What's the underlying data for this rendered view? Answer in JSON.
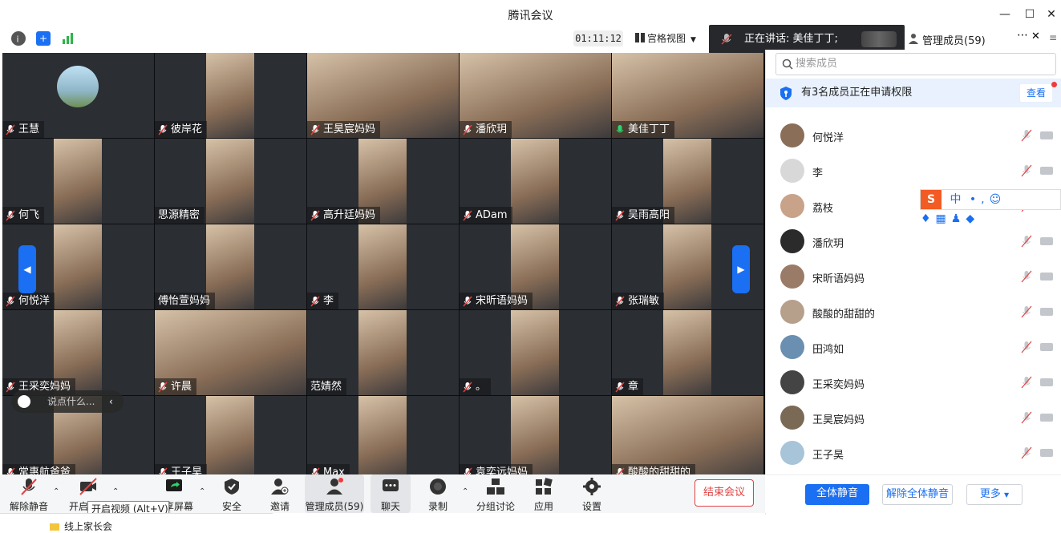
{
  "window": {
    "title": "腾讯会议"
  },
  "top_toolbar": {
    "timer": "01:11:12",
    "view_label": "宫格视图"
  },
  "speaking": {
    "text": "正在讲话: 美佳丁丁;"
  },
  "panel_header": {
    "title": "管理成员(59)"
  },
  "tiles": [
    [
      "王慧",
      "彼岸花",
      "王昊宸妈妈",
      "潘欣玥",
      "美佳丁丁"
    ],
    [
      "何飞",
      "思源精密",
      "高升廷妈妈",
      "ADam",
      "吴雨高阳"
    ],
    [
      "何悦洋",
      "傅怡萱妈妈",
      "李",
      "宋昕语妈妈",
      "张瑞敏"
    ],
    [
      "王采奕妈妈",
      "许晨",
      "范婧然",
      "。",
      "章"
    ],
    [
      "常惠航爸爸",
      "王子昊",
      "Max",
      "袁奕远妈妈",
      "酸酸的甜甜的"
    ]
  ],
  "chat_input": {
    "placeholder": "说点什么..."
  },
  "bottom_bar": {
    "unmute": "解除静音",
    "start_video": "开启视频",
    "share_screen": "共享屏幕",
    "security": "安全",
    "invite": "邀请",
    "manage_members": "管理成员(59)",
    "chat": "聊天",
    "record": "录制",
    "breakout": "分组讨论",
    "apps": "应用",
    "settings": "设置",
    "end_meeting": "结束会议"
  },
  "tooltip": "开启视频 (Alt+V)",
  "desktop": {
    "folder": "线上家长会"
  },
  "panel": {
    "search_placeholder": "搜索成员",
    "notice_text": "有3名成员正在申请权限",
    "notice_action": "查看",
    "members": [
      "何悦洋",
      "李",
      "荔枝",
      "潘欣玥",
      "宋昕语妈妈",
      "酸酸的甜甜的",
      "田鸿如",
      "王采奕妈妈",
      "王昊宸妈妈",
      "王子昊"
    ],
    "mute_all": "全体静音",
    "unmute_all": "解除全体静音",
    "more": "更多"
  },
  "ime": {
    "label": "中"
  },
  "colors": {
    "accent": "#1a6ff2",
    "danger": "#e04343",
    "speaking_bg": "#26282c"
  }
}
